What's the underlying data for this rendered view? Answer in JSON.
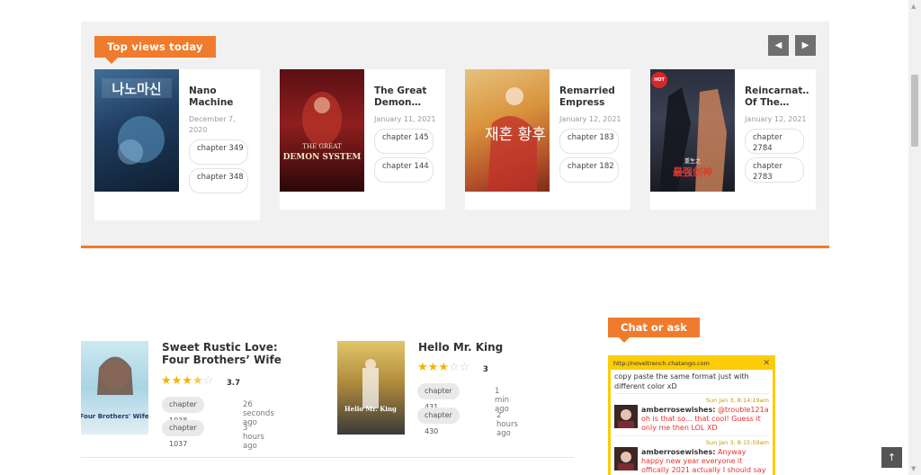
{
  "top_views": {
    "heading": "Top views today",
    "cards": [
      {
        "title": "Nano Machine",
        "date": "December 7, 2020",
        "chapters": [
          "chapter 349",
          "chapter 348"
        ],
        "cover_text": "나노마신",
        "hot": false
      },
      {
        "title": "The Great Demon…",
        "date": "January 11, 2021",
        "chapters": [
          "chapter 145",
          "chapter 144"
        ],
        "cover_text": "THE GREAT DEMON SYSTEM",
        "hot": false
      },
      {
        "title": "Remarried Empress",
        "date": "January 12, 2021",
        "chapters": [
          "chapter 183",
          "chapter 182"
        ],
        "cover_text": "재혼 황후",
        "hot": false
      },
      {
        "title": "Reincarnat… Of The…",
        "date": "January 12, 2021",
        "chapters": [
          "chapter 2784",
          "chapter 2783"
        ],
        "cover_text": "重生之最强剑神",
        "hot": true,
        "hot_label": "HOT"
      }
    ]
  },
  "latest": [
    {
      "title": "Sweet Rustic Love: Four Brothers’ Wife",
      "rating": "3.7",
      "stars": 3.5,
      "chapters": [
        {
          "label": "chapter 1038",
          "ago": "26 seconds ago"
        },
        {
          "label": "chapter 1037",
          "ago": "3 hours ago"
        }
      ],
      "cover_text": "Four Brothers' Wife"
    },
    {
      "title": "Hello Mr. King",
      "rating": "3",
      "stars": 3,
      "chapters": [
        {
          "label": "chapter 431",
          "ago": "1 min ago"
        },
        {
          "label": "chapter 430",
          "ago": "2 hours ago"
        }
      ],
      "cover_text": "Hello Mr. King"
    }
  ],
  "chat": {
    "heading": "Chat or ask",
    "url": "http://noveltrench.chatango.com",
    "prev_text": "copy paste the same format just with different color xD",
    "messages": [
      {
        "time": "Sun Jan 3, 8:14:19am",
        "user": "amberrosewishes:",
        "text_red": "@trouble121a oh is that so... that cool! Guess it only me then LOL",
        "text_plain": "XD"
      },
      {
        "time": "Sun Jan 3, 8:15:59am",
        "user": "amberrosewishes:",
        "text_red": "Anyway happy new year everyone it offically 2021 actually I should say",
        "text_plain": ""
      }
    ]
  },
  "colors": {
    "accent": "#f07b2d",
    "chat_border": "#fbcc07",
    "star": "#f5b301"
  }
}
